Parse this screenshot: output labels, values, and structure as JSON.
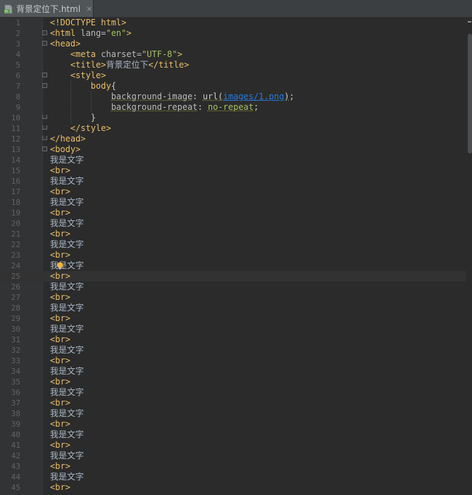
{
  "tab": {
    "title": "背景定位下.html",
    "close": "×"
  },
  "icons": {
    "file": "html-file-icon",
    "close": "close-icon",
    "bulb": "lightbulb-icon"
  },
  "colors": {
    "editor_bg": "#2b2b2b",
    "gutter_bg": "#313335",
    "tag": "#e8bf6a",
    "string": "#a5c25c",
    "link": "#287bde",
    "plain": "#a9b7c6",
    "line_number": "#606366"
  },
  "editor": {
    "current_line": 25,
    "lines": [
      {
        "n": "1",
        "tokens": [
          [
            "tag",
            "<!DOCTYPE html>"
          ]
        ]
      },
      {
        "n": "2",
        "tokens": [
          [
            "tag",
            "<html "
          ],
          [
            "attr",
            "lang="
          ],
          [
            "val",
            "\"en\""
          ],
          [
            "tag",
            ">"
          ]
        ]
      },
      {
        "n": "3",
        "tokens": [
          [
            "tag",
            "<head>"
          ]
        ]
      },
      {
        "n": "4",
        "tokens": [
          [
            "plain",
            "    "
          ],
          [
            "tag",
            "<meta "
          ],
          [
            "attr",
            "charset="
          ],
          [
            "val",
            "\"UTF-8\""
          ],
          [
            "tag",
            ">"
          ]
        ]
      },
      {
        "n": "5",
        "tokens": [
          [
            "plain",
            "    "
          ],
          [
            "tag",
            "<title>"
          ],
          [
            "cn",
            "背景定位下"
          ],
          [
            "tag",
            "</title>"
          ]
        ]
      },
      {
        "n": "6",
        "tokens": [
          [
            "plain",
            "    "
          ],
          [
            "tag",
            "<style>"
          ]
        ]
      },
      {
        "n": "7",
        "tokens": [
          [
            "plain",
            "        "
          ],
          [
            "sel",
            "body"
          ],
          [
            "white",
            "{"
          ]
        ]
      },
      {
        "n": "8",
        "tokens": [
          [
            "plain",
            "            "
          ],
          [
            "prop",
            "background-image"
          ],
          [
            "white",
            ": "
          ],
          [
            "fn",
            "url("
          ],
          [
            "link",
            "images/1.png"
          ],
          [
            "fn",
            ")"
          ],
          [
            "white",
            ";"
          ]
        ]
      },
      {
        "n": "9",
        "tokens": [
          [
            "plain",
            "            "
          ],
          [
            "prop",
            "background-repeat"
          ],
          [
            "white",
            ": "
          ],
          [
            "valgreen",
            "no-repeat"
          ],
          [
            "white",
            ";"
          ]
        ]
      },
      {
        "n": "10",
        "tokens": [
          [
            "plain",
            "        "
          ],
          [
            "white",
            "}"
          ]
        ]
      },
      {
        "n": "11",
        "tokens": [
          [
            "plain",
            "    "
          ],
          [
            "tag",
            "</style>"
          ]
        ]
      },
      {
        "n": "12",
        "tokens": [
          [
            "tag",
            "</head>"
          ]
        ]
      },
      {
        "n": "13",
        "tokens": [
          [
            "tag",
            "<body>"
          ]
        ]
      },
      {
        "n": "14",
        "tokens": [
          [
            "cn",
            "我是文字"
          ]
        ]
      },
      {
        "n": "15",
        "tokens": [
          [
            "tag",
            "<br>"
          ]
        ]
      },
      {
        "n": "16",
        "tokens": [
          [
            "cn",
            "我是文字"
          ]
        ]
      },
      {
        "n": "17",
        "tokens": [
          [
            "tag",
            "<br>"
          ]
        ]
      },
      {
        "n": "18",
        "tokens": [
          [
            "cn",
            "我是文字"
          ]
        ]
      },
      {
        "n": "19",
        "tokens": [
          [
            "tag",
            "<br>"
          ]
        ]
      },
      {
        "n": "20",
        "tokens": [
          [
            "cn",
            "我是文字"
          ]
        ]
      },
      {
        "n": "21",
        "tokens": [
          [
            "tag",
            "<br>"
          ]
        ]
      },
      {
        "n": "22",
        "tokens": [
          [
            "cn",
            "我是文字"
          ]
        ]
      },
      {
        "n": "23",
        "tokens": [
          [
            "tag",
            "<br>"
          ]
        ]
      },
      {
        "n": "24",
        "tokens": [
          [
            "cn",
            "我是文字"
          ]
        ]
      },
      {
        "n": "25",
        "tokens": [
          [
            "tag",
            "<br>"
          ]
        ]
      },
      {
        "n": "26",
        "tokens": [
          [
            "cn",
            "我是文字"
          ]
        ]
      },
      {
        "n": "27",
        "tokens": [
          [
            "tag",
            "<br>"
          ]
        ]
      },
      {
        "n": "28",
        "tokens": [
          [
            "cn",
            "我是文字"
          ]
        ]
      },
      {
        "n": "29",
        "tokens": [
          [
            "tag",
            "<br>"
          ]
        ]
      },
      {
        "n": "30",
        "tokens": [
          [
            "cn",
            "我是文字"
          ]
        ]
      },
      {
        "n": "31",
        "tokens": [
          [
            "tag",
            "<br>"
          ]
        ]
      },
      {
        "n": "32",
        "tokens": [
          [
            "cn",
            "我是文字"
          ]
        ]
      },
      {
        "n": "33",
        "tokens": [
          [
            "tag",
            "<br>"
          ]
        ]
      },
      {
        "n": "34",
        "tokens": [
          [
            "cn",
            "我是文字"
          ]
        ]
      },
      {
        "n": "35",
        "tokens": [
          [
            "tag",
            "<br>"
          ]
        ]
      },
      {
        "n": "36",
        "tokens": [
          [
            "cn",
            "我是文字"
          ]
        ]
      },
      {
        "n": "37",
        "tokens": [
          [
            "tag",
            "<br>"
          ]
        ]
      },
      {
        "n": "38",
        "tokens": [
          [
            "cn",
            "我是文字"
          ]
        ]
      },
      {
        "n": "39",
        "tokens": [
          [
            "tag",
            "<br>"
          ]
        ]
      },
      {
        "n": "40",
        "tokens": [
          [
            "cn",
            "我是文字"
          ]
        ]
      },
      {
        "n": "41",
        "tokens": [
          [
            "tag",
            "<br>"
          ]
        ]
      },
      {
        "n": "42",
        "tokens": [
          [
            "cn",
            "我是文字"
          ]
        ]
      },
      {
        "n": "43",
        "tokens": [
          [
            "tag",
            "<br>"
          ]
        ]
      },
      {
        "n": "44",
        "tokens": [
          [
            "cn",
            "我是文字"
          ]
        ]
      },
      {
        "n": "45",
        "tokens": [
          [
            "tag",
            "<br>"
          ]
        ]
      }
    ]
  }
}
